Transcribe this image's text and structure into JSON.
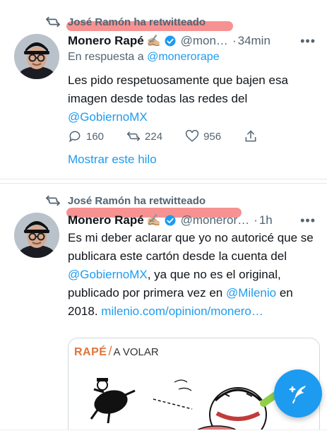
{
  "tweets": [
    {
      "retweeted_by": "José Ramón ha retwitteado",
      "display_name": "Monero Rapé",
      "emoji": "✍🏼",
      "handle": "@mon…",
      "separator": "·",
      "time": "34min",
      "more": "•••",
      "reply_prefix": "En respuesta a",
      "reply_handle": "@monerorape",
      "text_before_mention": "Les pido respetuosamente que bajen esa imagen desde todas las redes del",
      "text_mention": "@GobiernoMX",
      "replies": "160",
      "retweets": "224",
      "likes": "956",
      "thread_link": "Mostrar este hilo"
    },
    {
      "retweeted_by": "José Ramón ha retwitteado",
      "display_name": "Monero Rapé",
      "emoji": "✍🏼",
      "handle": "@moneror…",
      "separator": "·",
      "time": "1h",
      "more": "•••",
      "text_part1": "Es mi deber aclarar que yo no autoricé que se publicara este cartón desde la cuenta del",
      "mention1": "@GobiernoMX",
      "text_part2": ", ya que no es el original, publicado por primera vez en",
      "mention2": "@Milenio",
      "text_part3": "en 2018.",
      "url": "milenio.com/opinion/monero…",
      "card_brand": "RAPÉ",
      "card_slash": "/",
      "card_title": "A VOLAR"
    }
  ],
  "colors": {
    "accent": "#1d9bf0",
    "muted": "#536471",
    "highlight": "#f46e6e",
    "card_brand": "#e0743a"
  },
  "icons": [
    "retweet-icon",
    "verified-badge-icon",
    "reply-icon",
    "like-icon",
    "share-icon",
    "compose-tweet-icon"
  ]
}
